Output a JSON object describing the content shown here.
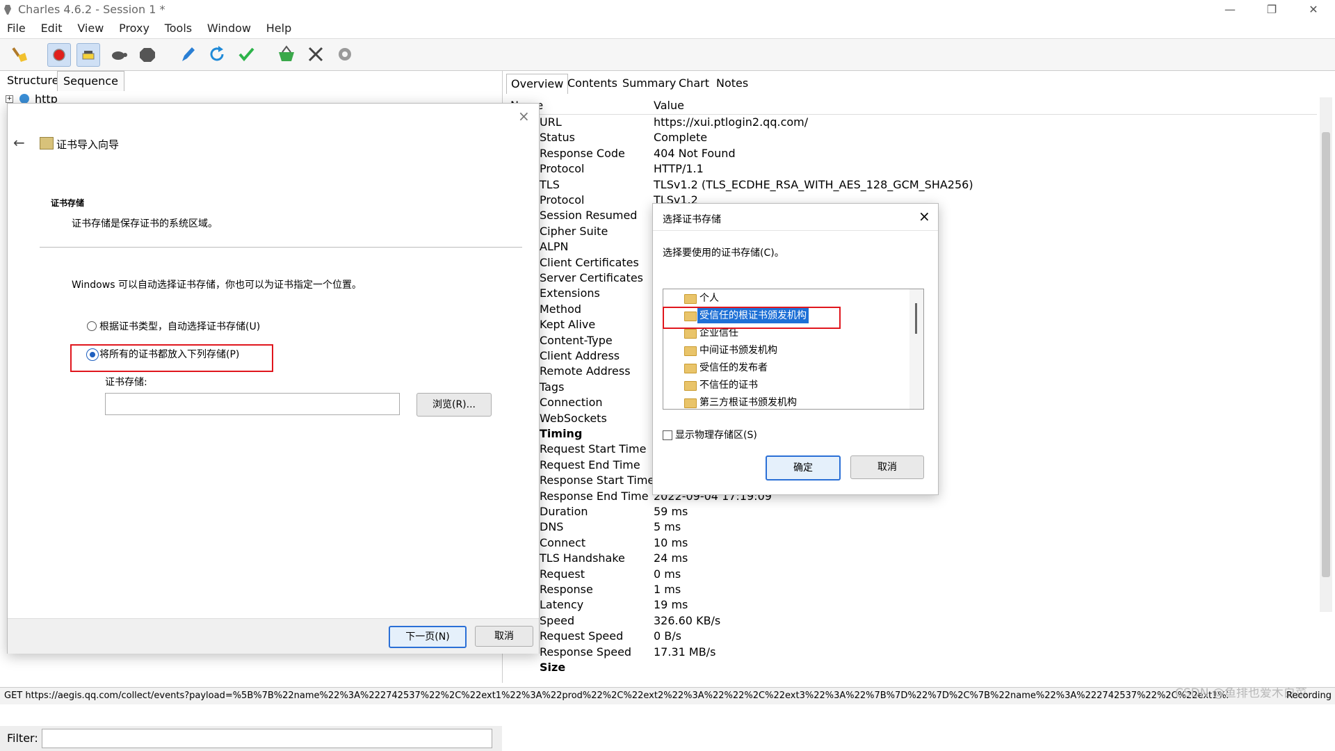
{
  "window": {
    "title": "Charles 4.6.2 - Session 1 *"
  },
  "menu": [
    "File",
    "Edit",
    "View",
    "Proxy",
    "Tools",
    "Window",
    "Help"
  ],
  "toolbar_icons": [
    "broom-icon",
    "record-icon",
    "throttle-icon",
    "turtle-icon",
    "stop-icon",
    "pen-icon",
    "refresh-icon",
    "check-icon",
    "basket-icon",
    "tools-icon",
    "gear-icon"
  ],
  "left_tabs": [
    "Structure",
    "Sequence"
  ],
  "left_tree": {
    "host": "http"
  },
  "filter_label": "Filter:",
  "right_tabs": [
    "Overview",
    "Contents",
    "Summary",
    "Chart",
    "Notes"
  ],
  "table_headers": {
    "name": "Name",
    "value": "Value"
  },
  "overview_rows": [
    {
      "name": "URL",
      "value": "https://xui.ptlogin2.qq.com/"
    },
    {
      "name": "Status",
      "value": "Complete"
    },
    {
      "name": "Response Code",
      "value": "404 Not Found"
    },
    {
      "name": "Protocol",
      "value": "HTTP/1.1"
    },
    {
      "name": "TLS",
      "value": "TLSv1.2 (TLS_ECDHE_RSA_WITH_AES_128_GCM_SHA256)"
    },
    {
      "name": "Protocol",
      "value": "TLSv1.2"
    },
    {
      "name": "Session Resumed",
      "value": ""
    },
    {
      "name": "Cipher Suite",
      "value": ""
    },
    {
      "name": "ALPN",
      "value": ""
    },
    {
      "name": "Client Certificates",
      "value": ""
    },
    {
      "name": "Server Certificates",
      "value": ""
    },
    {
      "name": "Extensions",
      "value": ""
    },
    {
      "name": "Method",
      "value": ""
    },
    {
      "name": "Kept Alive",
      "value": ""
    },
    {
      "name": "Content-Type",
      "value": ""
    },
    {
      "name": "Client Address",
      "value": ""
    },
    {
      "name": "Remote Address",
      "value": ""
    },
    {
      "name": "Tags",
      "value": ""
    },
    {
      "name": "Connection",
      "value": ""
    },
    {
      "name": "WebSockets",
      "value": ""
    },
    {
      "name": "Timing",
      "value": ""
    },
    {
      "name": "Request Start Time",
      "value": ""
    },
    {
      "name": "Request End Time",
      "value": ""
    },
    {
      "name": "Response Start Time",
      "value": ""
    },
    {
      "name": "Response End Time",
      "value": "2022-09-04 17:19:09"
    },
    {
      "name": "Duration",
      "value": "59 ms"
    },
    {
      "name": "DNS",
      "value": "5 ms"
    },
    {
      "name": "Connect",
      "value": "10 ms"
    },
    {
      "name": "TLS Handshake",
      "value": "24 ms"
    },
    {
      "name": "Request",
      "value": "0 ms"
    },
    {
      "name": "Response",
      "value": "1 ms"
    },
    {
      "name": "Latency",
      "value": "19 ms"
    },
    {
      "name": "Speed",
      "value": "326.60 KB/s"
    },
    {
      "name": "Request Speed",
      "value": "0 B/s"
    },
    {
      "name": "Response Speed",
      "value": "17.31 MB/s"
    },
    {
      "name": "Size",
      "value": ""
    }
  ],
  "status_bar": {
    "text": "GET https://aegis.qq.com/collect/events?payload=%5B%7B%22name%22%3A%222742537%22%2C%22ext1%22%3A%22prod%22%2C%22ext2%22%3A%22%22%2C%22ext3%22%3A%22%7B%7D%22%7D%2C%7B%22name%22%3A%222742537%22%2C%22ext1%22%3A%22prod%22%2C%22ext2%22%3A...",
    "watermark": "CSDN @鱼排也爱木白菜",
    "right": "Recording"
  },
  "wizard": {
    "title": "证书导入向导",
    "section_title": "证书存储",
    "section_desc": "证书存储是保存证书的系统区域。",
    "info": "Windows 可以自动选择证书存储，你也可以为证书指定一个位置。",
    "radio_auto": "根据证书类型，自动选择证书存储(U)",
    "radio_manual": "将所有的证书都放入下列存储(P)",
    "store_label": "证书存储:",
    "store_value": "",
    "browse_btn": "浏览(R)...",
    "next_btn": "下一页(N)",
    "cancel_btn": "取消",
    "close": "×"
  },
  "cert_dialog": {
    "title": "选择证书存储",
    "instruction": "选择要使用的证书存储(C)。",
    "items": [
      "个人",
      "受信任的根证书颁发机构",
      "企业信任",
      "中间证书颁发机构",
      "受信任的发布者",
      "不信任的证书",
      "第三方根证书颁发机构"
    ],
    "selected_index": 1,
    "show_physical": "显示物理存储区(S)",
    "ok_btn": "确定",
    "cancel_btn": "取消",
    "close": "×"
  }
}
